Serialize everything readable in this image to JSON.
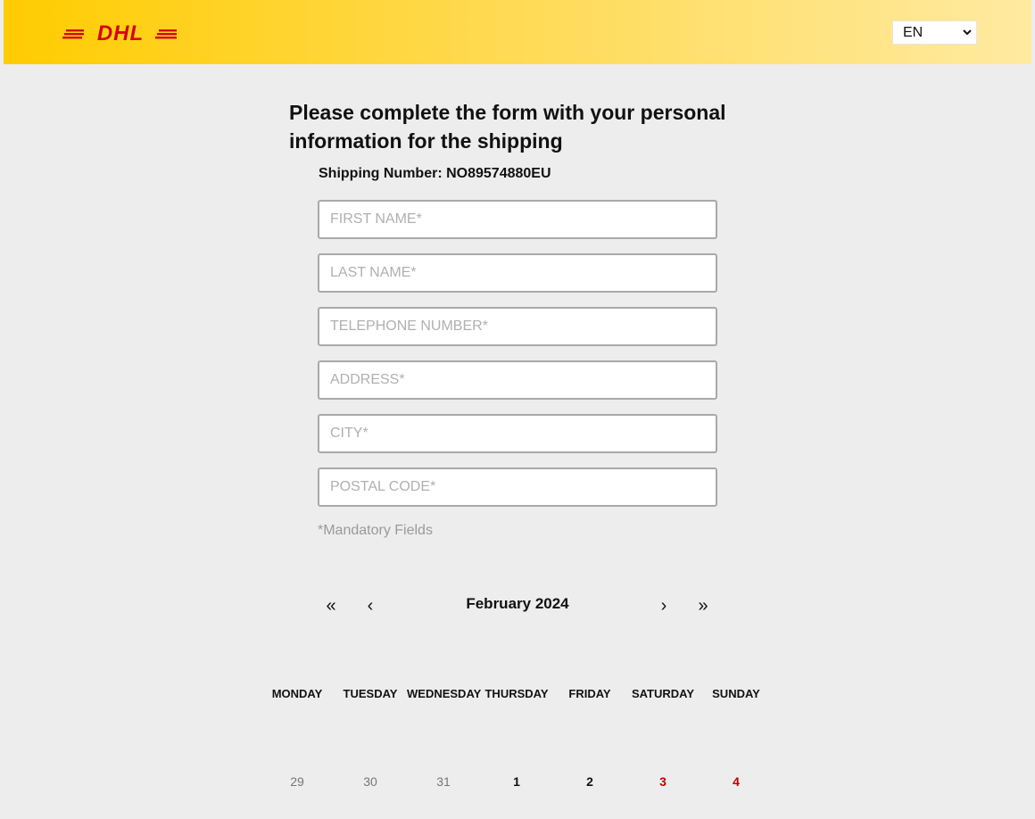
{
  "header": {
    "logo_text": "DHL",
    "language": {
      "selected": "EN"
    }
  },
  "form": {
    "title": "Please complete the form with your personal information for the shipping",
    "shipping_number": "Shipping Number: NO89574880EU",
    "fields": {
      "first_name": {
        "placeholder": "FIRST NAME*",
        "value": ""
      },
      "last_name": {
        "placeholder": "LAST NAME*",
        "value": ""
      },
      "telephone": {
        "placeholder": "TELEPHONE NUMBER*",
        "value": ""
      },
      "address": {
        "placeholder": "ADDRESS*",
        "value": ""
      },
      "city": {
        "placeholder": "CITY*",
        "value": ""
      },
      "postal_code": {
        "placeholder": "POSTAL CODE*",
        "value": ""
      }
    },
    "mandatory_note": "*Mandatory Fields"
  },
  "calendar": {
    "month_label": "February 2024",
    "nav": {
      "prev_year": "«",
      "prev_month": "‹",
      "next_month": "›",
      "next_year": "»"
    },
    "weekdays": [
      "MONDAY",
      "TUESDAY",
      "WEDNESDAY",
      "THURSDAY",
      "FRIDAY",
      "SATURDAY",
      "SUNDAY"
    ],
    "first_row": [
      "29",
      "30",
      "31",
      "1",
      "2",
      "3",
      "4"
    ]
  },
  "colors": {
    "brand_yellow": "#ffcc00",
    "brand_red": "#d40511",
    "weekend_red": "#c00000"
  }
}
